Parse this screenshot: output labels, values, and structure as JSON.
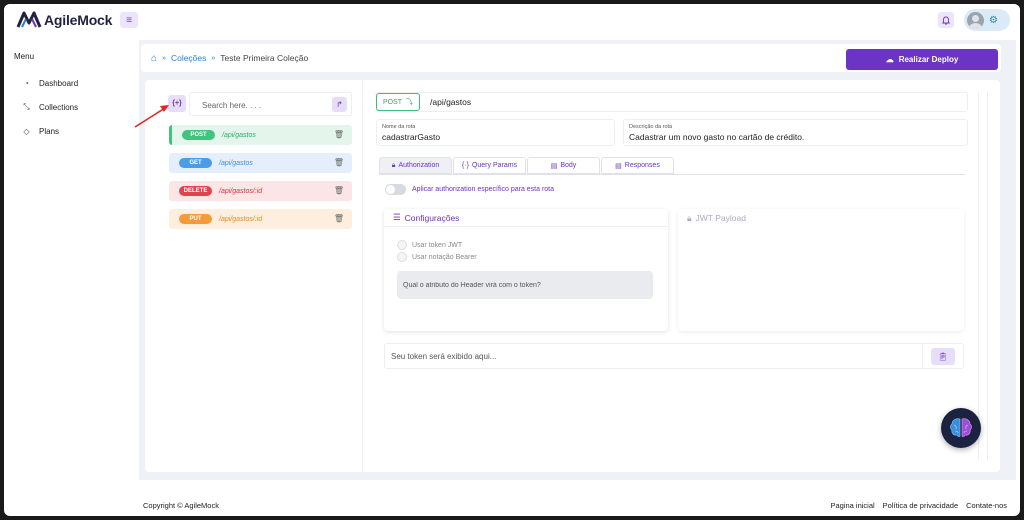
{
  "app": {
    "name": "AgileMock"
  },
  "header": {
    "menu_icon": "hamburger-icon",
    "bell_icon": "bell-icon",
    "settings_icon": "gear-icon"
  },
  "sidebar": {
    "title": "Menu",
    "items": [
      {
        "label": "Dashboard",
        "icon": "dashboard-icon"
      },
      {
        "label": "Collections",
        "icon": "collections-icon"
      },
      {
        "label": "Plans",
        "icon": "tag-icon"
      }
    ]
  },
  "breadcrumb": {
    "collections": "Coleções",
    "current": "Teste Primeira Coleção"
  },
  "deploy": {
    "label": "Realizar Deploy"
  },
  "search": {
    "placeholder": "Search here. . . ."
  },
  "add_button": {
    "label": "{+}"
  },
  "routes": [
    {
      "method": "POST",
      "path": "/api/gastos",
      "color": "#41c47e",
      "bg": "#e4f6ec",
      "text": "#2fa96a"
    },
    {
      "method": "GET",
      "path": "/api/gastos",
      "color": "#4a9de6",
      "bg": "#e4effb",
      "text": "#3a8edb"
    },
    {
      "method": "DELETE",
      "path": "/api/gastos/:id",
      "color": "#e0434b",
      "bg": "#fbe5e6",
      "text": "#d8343c"
    },
    {
      "method": "PUT",
      "path": "/api/gastos/:id",
      "color": "#f39a3c",
      "bg": "#fdeedd",
      "text": "#e98a22"
    }
  ],
  "editor": {
    "method": "POST",
    "url": "/api/gastos",
    "name_label": "Nome da rota",
    "name_value": "cadastrarGasto",
    "desc_label": "Descrição da rota",
    "desc_value": "Cadastrar um novo gasto no cartão de crédito.",
    "tabs": [
      {
        "label": "Authorization",
        "icon": "lock-icon"
      },
      {
        "label": "Query Params",
        "icon": "braces-icon"
      },
      {
        "label": "Body",
        "icon": "document-icon"
      },
      {
        "label": "Responses",
        "icon": "document-icon"
      }
    ],
    "toggle_label": "Aplicar authorization específico para esta rota",
    "config_title": "Configurações",
    "use_jwt": "Usar token JWT",
    "use_bearer": "Usar notação Bearer",
    "header_placeholder": "Qual o atributo do Header virá com o token?",
    "jwt_title": "JWT Payload",
    "token_placeholder": "Seu token será exibido aqui..."
  },
  "footer": {
    "copyright": "Copyright © AgileMock",
    "links": [
      "Pagina inicial",
      "Política de privacidade",
      "Contate-nos"
    ]
  },
  "colors": {
    "accent": "#6b34c2",
    "link": "#2a7fd4",
    "annotation": "#e32424"
  }
}
